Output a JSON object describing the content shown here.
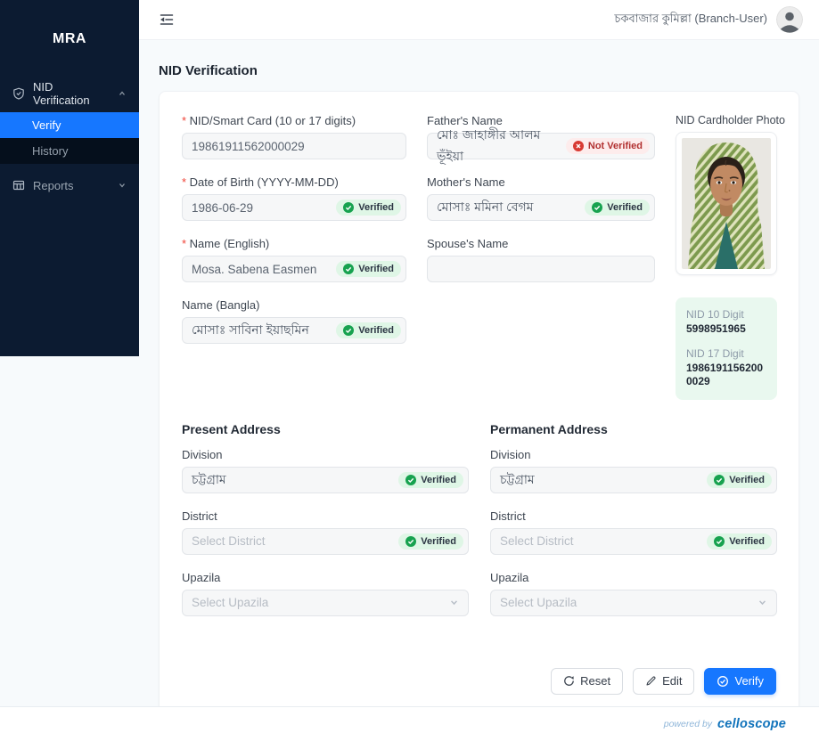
{
  "sidebar": {
    "logo": "MRA",
    "nid_verification": "NID Verification",
    "verify": "Verify",
    "history": "History",
    "reports": "Reports"
  },
  "header": {
    "user": "চকবাজার কুমিল্লা (Branch-User)"
  },
  "page": {
    "title": "NID Verification"
  },
  "form": {
    "nid": {
      "label": "NID/Smart Card (10 or 17 digits)",
      "value": "19861911562000029"
    },
    "dob": {
      "label": "Date of Birth (YYYY-MM-DD)",
      "value": "1986-06-29",
      "status": "Verified"
    },
    "name_en": {
      "label": "Name (English)",
      "value": "Mosa. Sabena Easmen",
      "status": "Verified"
    },
    "name_bn": {
      "label": "Name (Bangla)",
      "value": "মোসাঃ সাবিনা ইয়াছমিন",
      "status": "Verified"
    },
    "father": {
      "label": "Father's Name",
      "value": "মোঃ জাহাঙ্গীর আলম ভূঁইয়া",
      "status": "Not Verified"
    },
    "mother": {
      "label": "Mother's Name",
      "value": "মোসাঃ মমিনা বেগম",
      "status": "Verified"
    },
    "spouse": {
      "label": "Spouse's Name",
      "value": ""
    }
  },
  "photo": {
    "label": "NID Cardholder Photo"
  },
  "nid_summary": {
    "ten_label": "NID 10 Digit",
    "ten_value": "5998951965",
    "seventeen_label": "NID 17 Digit",
    "seventeen_value": "19861911562000029"
  },
  "present_address": {
    "title": "Present Address",
    "division": {
      "label": "Division",
      "value": "চট্টগ্রাম",
      "status": "Verified"
    },
    "district": {
      "label": "District",
      "placeholder": "Select District",
      "status": "Verified"
    },
    "upazila": {
      "label": "Upazila",
      "placeholder": "Select Upazila"
    }
  },
  "permanent_address": {
    "title": "Permanent Address",
    "division": {
      "label": "Division",
      "value": "চট্টগ্রাম",
      "status": "Verified"
    },
    "district": {
      "label": "District",
      "placeholder": "Select District",
      "status": "Verified"
    },
    "upazila": {
      "label": "Upazila",
      "placeholder": "Select Upazila"
    }
  },
  "actions": {
    "reset": "Reset",
    "edit": "Edit",
    "verify": "Verify"
  },
  "footer": {
    "powered_by": "powered by",
    "brand": "celloscope"
  },
  "colors": {
    "accent": "#1677ff",
    "sidebar_bg": "#0c1b31",
    "verified_bg": "#dff6e6",
    "verified_icon": "#17a24f",
    "not_verified_bg": "#fdecec",
    "not_verified_icon": "#d83a33"
  }
}
